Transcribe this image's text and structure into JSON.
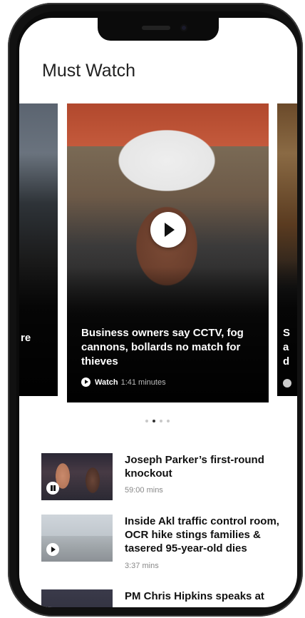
{
  "section": {
    "title": "Must Watch"
  },
  "carousel": {
    "left_card_partial_text": "re",
    "main_card": {
      "headline": "Business owners say CCTV, fog cannons, bollards no match for thieves",
      "watch_label": "Watch",
      "duration": "1:41 minutes"
    },
    "right_card_partial_text": "S a d",
    "dots": {
      "count": 4,
      "active_index": 1
    }
  },
  "list": [
    {
      "title": "Joseph Parker’s first-round knockout",
      "meta": "59:00 mins",
      "icon": "pause-icon"
    },
    {
      "title": "Inside Akl traffic control room, OCR hike stings families & tasered 95-year-old dies",
      "meta": "3:37 mins",
      "icon": "play-icon"
    },
    {
      "title": "PM Chris Hipkins speaks at",
      "meta": "",
      "icon": "play-icon"
    }
  ]
}
